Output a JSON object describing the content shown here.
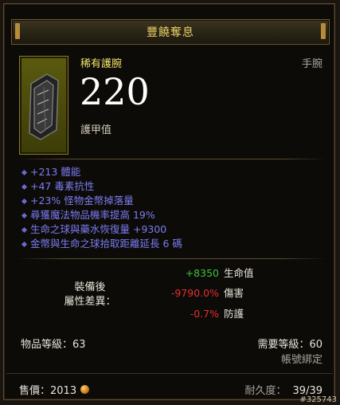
{
  "title": "豐饒奪息",
  "item": {
    "type_label": "稀有護腕",
    "slot_label": "手腕",
    "armor_value": "220",
    "armor_label": "護甲值",
    "icon": "bracer-icon"
  },
  "affixes": [
    "+213 體能",
    "+47 毒素抗性",
    "+23% 怪物金幣掉落量",
    "尋獲魔法物品機率提高 19%",
    "生命之球與藥水恢復量 +9300",
    "金幣與生命之球拾取距離延長 6 碼"
  ],
  "comparison": {
    "label_line1": "裝備後",
    "label_line2": "屬性差異：",
    "stats": [
      {
        "value": "+8350",
        "name": "生命值",
        "kind": "pos"
      },
      {
        "value": "-9790.0%",
        "name": "傷害",
        "kind": "neg"
      },
      {
        "value": "-0.7%",
        "name": "防護",
        "kind": "neg"
      }
    ]
  },
  "levels": {
    "item_level": "物品等級：63",
    "required_level": "需要等級：60",
    "bind": "帳號綁定"
  },
  "footer": {
    "sell_label": "售價：2013",
    "durability_label": "耐久度：",
    "durability_value": "39/39",
    "watermark": "#325743"
  },
  "colors": {
    "title": "#e9cf64",
    "rare": "#f0e36a",
    "magic_affix": "#7b7cf2",
    "positive": "#3ec23e",
    "negative": "#e23030"
  }
}
